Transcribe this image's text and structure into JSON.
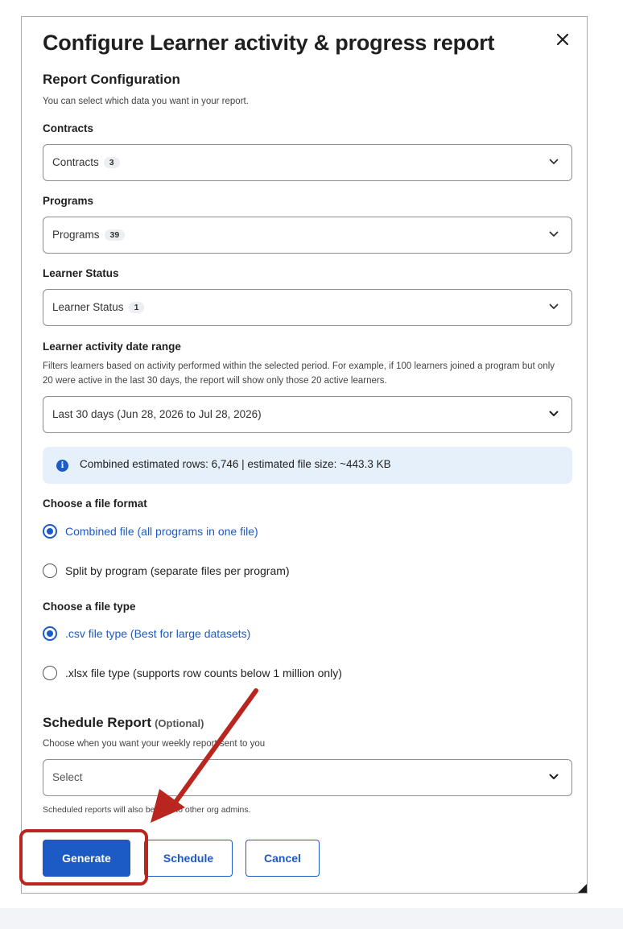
{
  "modal": {
    "title": "Configure Learner activity & progress report",
    "close_icon": "close-icon"
  },
  "config": {
    "heading": "Report Configuration",
    "help": "You can select which data you want in your report."
  },
  "contracts": {
    "label": "Contracts",
    "value": "Contracts",
    "count": "3"
  },
  "programs": {
    "label": "Programs",
    "value": "Programs",
    "count": "39"
  },
  "learner_status": {
    "label": "Learner Status",
    "value": "Learner Status",
    "count": "1"
  },
  "date_range": {
    "label": "Learner activity date range",
    "help": "Filters learners based on activity performed within the selected period. For example, if 100 learners joined a program but only 20 were active in the last 30 days, the report will show only those 20 active learners.",
    "value": "Last 30 days (Jun 28, 2026 to Jul 28, 2026)"
  },
  "info": {
    "text": "Combined estimated rows: 6,746 | estimated file size: ~443.3 KB",
    "icon": "i"
  },
  "file_format": {
    "label": "Choose a file format",
    "options": [
      {
        "label": "Combined file (all programs in one file)",
        "selected": true
      },
      {
        "label": "Split by program (separate files per program)",
        "selected": false
      }
    ]
  },
  "file_type": {
    "label": "Choose a file type",
    "options": [
      {
        "label": ".csv file type (Best for large datasets)",
        "selected": true
      },
      {
        "label": ".xlsx file type (supports row counts below 1 million only)",
        "selected": false
      }
    ]
  },
  "schedule": {
    "title": "Schedule Report",
    "optional": "(Optional)",
    "help": "Choose when you want your weekly report sent to you",
    "placeholder": "Select",
    "note": "Scheduled reports will also be sent to other org admins."
  },
  "buttons": {
    "generate": "Generate",
    "schedule": "Schedule",
    "cancel": "Cancel"
  },
  "colors": {
    "accent": "#1c5ac5",
    "annotation": "#b8261f",
    "info_bg": "#e6f0fb"
  }
}
